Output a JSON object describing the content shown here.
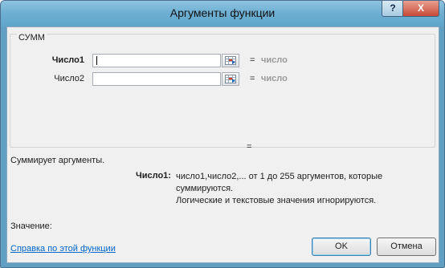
{
  "window": {
    "title": "Аргументы функции",
    "help_glyph": "?",
    "close_glyph": "X"
  },
  "function": {
    "name": "СУММ"
  },
  "arguments": [
    {
      "label": "Число1",
      "value": "",
      "result": "число"
    },
    {
      "label": "Число2",
      "value": "",
      "result": "число"
    }
  ],
  "equals": "=",
  "result_equals": "=",
  "description": "Суммирует аргументы.",
  "arg_help": {
    "name": "Число1:",
    "line1": "число1,число2,... от 1 до 255 аргументов, которые суммируются.",
    "line2": "Логические и текстовые значения игнорируются."
  },
  "value_label": "Значение:",
  "help_link": "Справка по этой функции",
  "buttons": {
    "ok": "OK",
    "cancel": "Отмена"
  }
}
